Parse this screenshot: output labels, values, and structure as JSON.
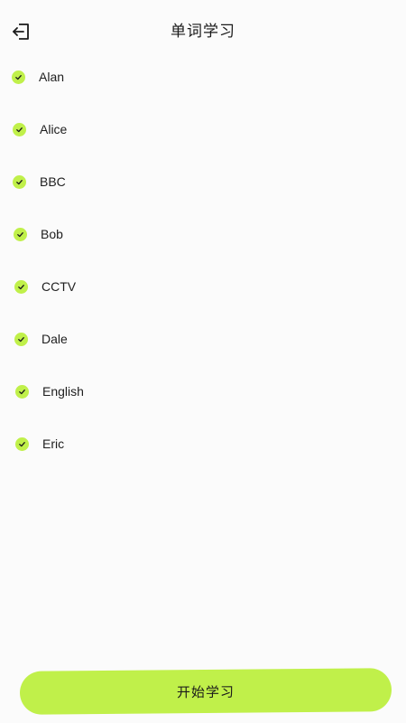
{
  "header": {
    "title": "单词学习",
    "back_icon": "exit-arrow-icon"
  },
  "accent_color": "#c0f04a",
  "words": [
    {
      "label": "Alan",
      "checked": true
    },
    {
      "label": "Alice",
      "checked": true
    },
    {
      "label": "BBC",
      "checked": true
    },
    {
      "label": "Bob",
      "checked": true
    },
    {
      "label": "CCTV",
      "checked": true
    },
    {
      "label": "Dale",
      "checked": true
    },
    {
      "label": "English",
      "checked": true
    },
    {
      "label": "Eric",
      "checked": true
    }
  ],
  "footer": {
    "start_label": "开始学习"
  }
}
